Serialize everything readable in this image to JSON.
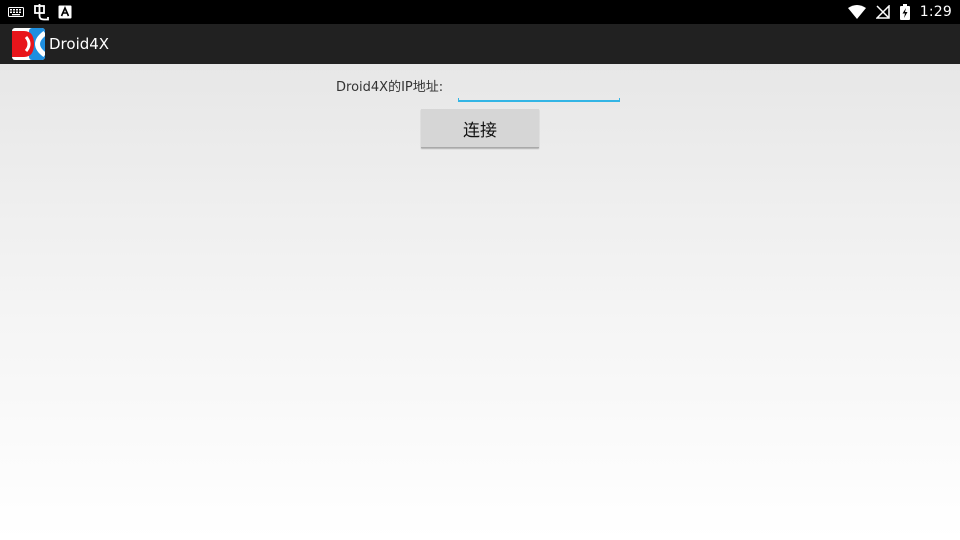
{
  "status_bar": {
    "left_icons": [
      "keyboard-icon",
      "bug-icon",
      "app-a-icon"
    ],
    "right_icons": [
      "wifi-icon",
      "signal-off-icon",
      "battery-charging-icon"
    ],
    "time": "1:29"
  },
  "action_bar": {
    "app_icon": "droid4x-logo-icon",
    "title": "Droid4X"
  },
  "form": {
    "ip_label": "Droid4X的IP地址:",
    "ip_value": "",
    "connect_label": "连接"
  },
  "colors": {
    "status_bar_bg": "#000000",
    "action_bar_bg": "#212121",
    "input_accent": "#33b5e5",
    "button_bg": "#d6d6d6"
  }
}
